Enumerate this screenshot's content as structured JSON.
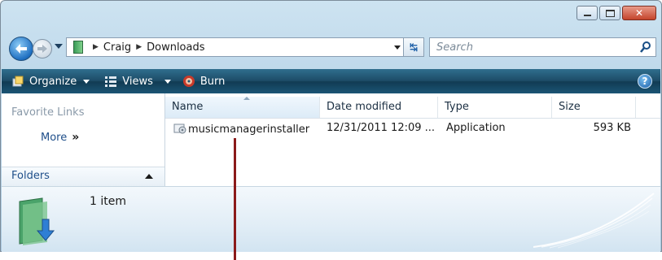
{
  "window": {
    "caption_buttons": [
      {
        "name": "minimize-button",
        "glyph": "minimize-icon"
      },
      {
        "name": "maximize-button",
        "glyph": "maximize-icon"
      },
      {
        "name": "close-button",
        "glyph": "close-icon"
      }
    ]
  },
  "address": {
    "path": [
      "Craig",
      "Downloads"
    ]
  },
  "search": {
    "placeholder": "Search"
  },
  "toolbar": {
    "organize": "Organize",
    "views": "Views",
    "burn": "Burn",
    "help": "?"
  },
  "leftpane": {
    "favorite_links": "Favorite Links",
    "more": "More",
    "more_glyph": "»",
    "folders": "Folders"
  },
  "columns": {
    "name": "Name",
    "date": "Date modified",
    "type": "Type",
    "size": "Size"
  },
  "files": [
    {
      "name": "musicmanagerinstaller",
      "date": "12/31/2011 12:09 ...",
      "type": "Application",
      "size": "593 KB"
    }
  ],
  "details": {
    "count": "1 item"
  },
  "colors": {
    "toolbar": "#1d4c67",
    "callout": "#8b1a1a"
  }
}
